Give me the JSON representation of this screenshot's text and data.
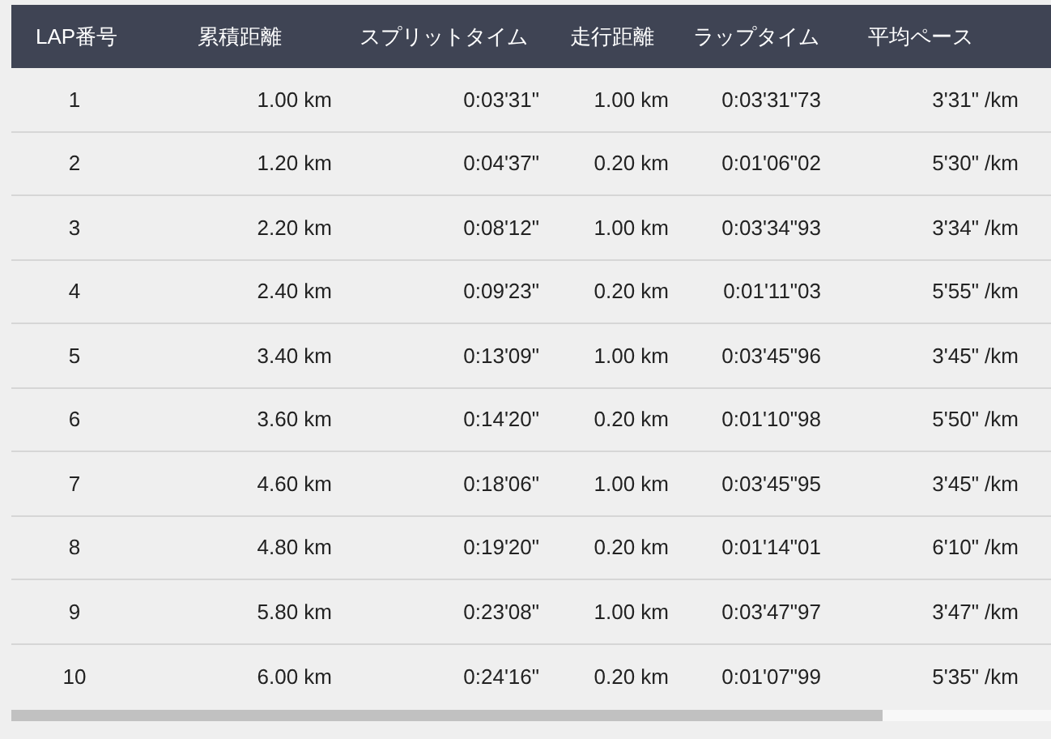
{
  "table": {
    "columns": [
      "LAP番号",
      "累積距離",
      "スプリットタイム",
      "走行距離",
      "ラップタイム",
      "平均ペース"
    ],
    "rows": [
      [
        "1",
        "1.00 km",
        "0:03'31\"",
        "1.00 km",
        "0:03'31\"73",
        "3'31\" /km"
      ],
      [
        "2",
        "1.20 km",
        "0:04'37\"",
        "0.20 km",
        "0:01'06\"02",
        "5'30\" /km"
      ],
      [
        "3",
        "2.20 km",
        "0:08'12\"",
        "1.00 km",
        "0:03'34\"93",
        "3'34\" /km"
      ],
      [
        "4",
        "2.40 km",
        "0:09'23\"",
        "0.20 km",
        "0:01'11\"03",
        "5'55\" /km"
      ],
      [
        "5",
        "3.40 km",
        "0:13'09\"",
        "1.00 km",
        "0:03'45\"96",
        "3'45\" /km"
      ],
      [
        "6",
        "3.60 km",
        "0:14'20\"",
        "0.20 km",
        "0:01'10\"98",
        "5'50\" /km"
      ],
      [
        "7",
        "4.60 km",
        "0:18'06\"",
        "1.00 km",
        "0:03'45\"95",
        "3'45\" /km"
      ],
      [
        "8",
        "4.80 km",
        "0:19'20\"",
        "0.20 km",
        "0:01'14\"01",
        "6'10\" /km"
      ],
      [
        "9",
        "5.80 km",
        "0:23'08\"",
        "1.00 km",
        "0:03'47\"97",
        "3'47\" /km"
      ],
      [
        "10",
        "6.00 km",
        "0:24'16\"",
        "0.20 km",
        "0:01'07\"99",
        "5'35\" /km"
      ]
    ]
  }
}
